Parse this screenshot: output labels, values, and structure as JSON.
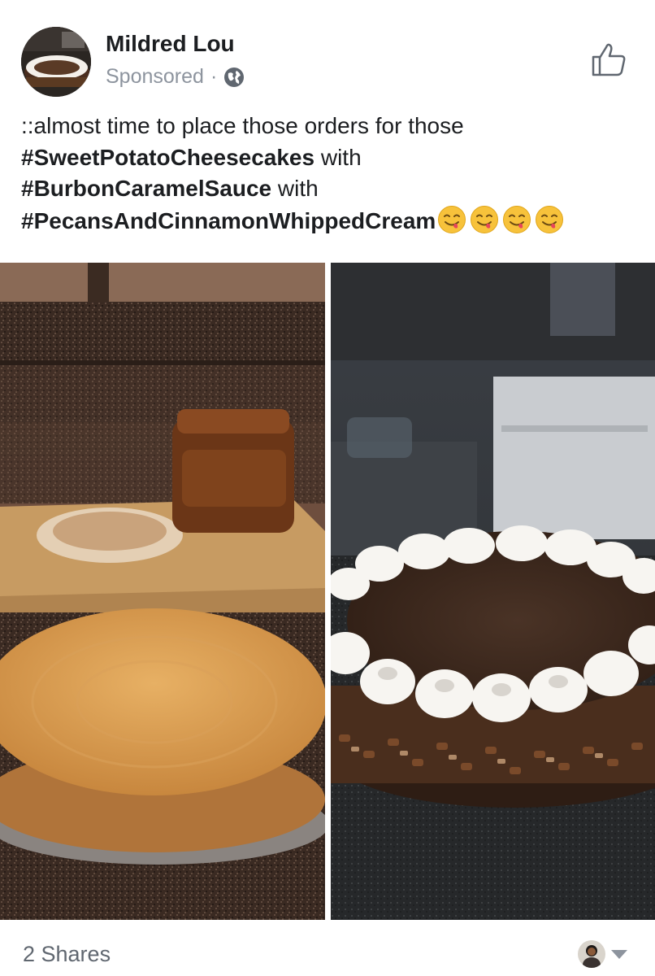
{
  "post": {
    "author": "Mildred Lou",
    "sponsored": "Sponsored",
    "separator": "·",
    "text": {
      "line1": "::almost time to place those orders for those",
      "tag1": "#SweetPotatoCheesecakes",
      "with1": " with",
      "tag2": "#BurbonCaramelSauce",
      "with2": " with",
      "tag3": "#PecansAndCinnamonWhippedCream"
    },
    "emoji_count": 4,
    "emoji_icon": "yum-face-emoji"
  },
  "footer": {
    "shares": "2 Shares"
  },
  "icons": {
    "privacy": "globe-icon",
    "like": "thumbs-up-icon",
    "menu": "chevron-down-icon"
  },
  "colors": {
    "author": "#1c1e21",
    "secondary_text": "#8d949e",
    "shares_text": "#606770"
  }
}
